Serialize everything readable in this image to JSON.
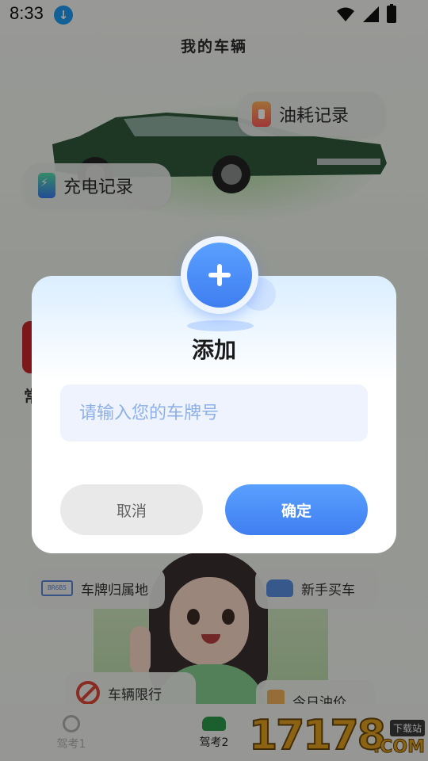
{
  "status_bar": {
    "time": "8:33"
  },
  "page": {
    "title": "我的车辆"
  },
  "quick_actions": {
    "fuel_record": "油耗记录",
    "charge_record": "充电记录"
  },
  "partial_text": {
    "side_char": "常"
  },
  "services": {
    "plate_location": "车牌归属地",
    "plate_icon_text": "BR6B5",
    "new_car": "新手买车",
    "vehicle_limit": "车辆限行",
    "today_oil_price": "今日油价"
  },
  "tabbar": {
    "tab1": "驾考1",
    "tab2": "驾考2"
  },
  "watermark": {
    "number": "17178",
    "tag": "下载站",
    "domain": ".COM"
  },
  "dialog": {
    "title": "添加",
    "input_placeholder": "请输入您的车牌号",
    "input_value": "",
    "cancel_label": "取消",
    "confirm_label": "确定"
  },
  "colors": {
    "primary": "#3f7ef0",
    "accent_light": "#eef3fd",
    "cancel_bg": "#e9e9e9"
  }
}
